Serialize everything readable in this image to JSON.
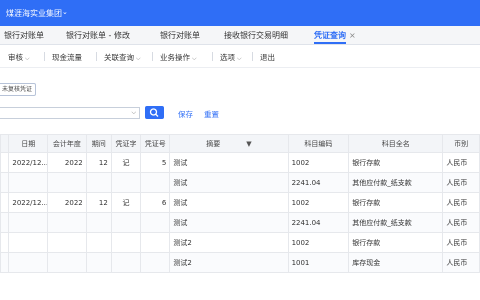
{
  "header": {
    "org_name": "煤涯海实业集团",
    "chevron": "⌄"
  },
  "tabs": [
    {
      "label": "银行对账单"
    },
    {
      "label": "银行对账单 - 修改"
    },
    {
      "label": "银行对账单"
    },
    {
      "label": "接收银行交易明细"
    },
    {
      "label": "凭证查询",
      "active": true,
      "close": "×"
    }
  ],
  "toolbar": {
    "items": [
      "审核",
      "现金流量",
      "关联查询",
      "业务操作",
      "选项",
      "退出"
    ],
    "dropdown_glyph": "⌵"
  },
  "hint_button": "未复核凭证",
  "search": {
    "value": "",
    "placeholder": ""
  },
  "links": {
    "save": "保存",
    "reset": "重置"
  },
  "table": {
    "headers": [
      "日期",
      "会计年度",
      "期间",
      "凭证字",
      "凭证号",
      "摘要",
      "科目编码",
      "科目全名",
      "币别"
    ],
    "rows": [
      [
        "2022/12...",
        "2022",
        "12",
        "记",
        "5",
        "测试",
        "1002",
        "银行存款",
        "人民币"
      ],
      [
        "",
        "",
        "",
        "",
        "",
        "测试",
        "2241.04",
        "其他应付款_纸支款",
        "人民币"
      ],
      [
        "2022/12...",
        "2022",
        "12",
        "记",
        "6",
        "测试",
        "1002",
        "银行存款",
        "人民币"
      ],
      [
        "",
        "",
        "",
        "",
        "",
        "测试",
        "2241.04",
        "其他应付款_纸支款",
        "人民币"
      ],
      [
        "",
        "",
        "",
        "",
        "",
        "测试2",
        "1002",
        "银行存款",
        "人民币"
      ],
      [
        "",
        "",
        "",
        "",
        "",
        "测试2",
        "1001",
        "库存现金",
        "人民币"
      ]
    ]
  },
  "colors": {
    "brand": "#2f6ef6"
  }
}
